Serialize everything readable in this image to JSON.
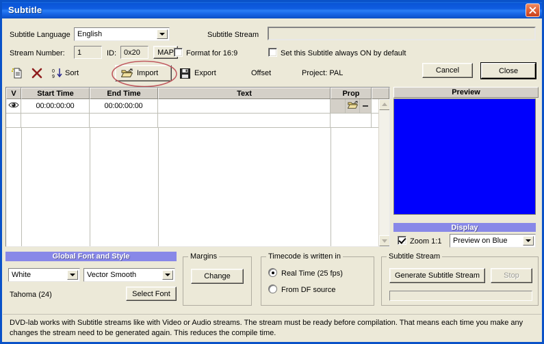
{
  "window": {
    "title": "Subtitle",
    "close_icon": "close-icon"
  },
  "top": {
    "language_label": "Subtitle Language",
    "language_value": "English",
    "stream_label": "Subtitle Stream",
    "stream_value": "",
    "stream_number_label": "Stream Number:",
    "stream_number_value": "1",
    "id_label": "ID:",
    "id_value": "0x20",
    "map_button": "MAP",
    "format_169_label": "Format for 16:9",
    "format_169_checked": false,
    "always_on_label": "Set this Subtitle always ON by default",
    "always_on_checked": false
  },
  "toolbar": {
    "new_icon": "new-document-icon",
    "delete_icon": "delete-x-icon",
    "sort_icon": "sort-icon",
    "sort_label": "Sort",
    "import_icon": "open-folder-icon",
    "import_label": "Import",
    "export_icon": "floppy-disk-icon",
    "export_label": "Export",
    "offset_label": "Offset",
    "project_label": "Project: PAL",
    "cancel_label": "Cancel",
    "close_label": "Close"
  },
  "grid": {
    "columns": [
      "V",
      "Start Time",
      "End Time",
      "Text",
      "Prop",
      ""
    ],
    "rows": [
      {
        "visible_icon": "eye-icon",
        "start_time": "00:00:00:00",
        "end_time": "00:00:00:00",
        "text": "",
        "prop_folder_icon": "open-folder-icon",
        "prop_minus_icon": "minus-icon"
      }
    ],
    "scroll_up_icon": "scroll-up-arrow-icon",
    "scroll_down_icon": "scroll-down-arrow-icon"
  },
  "preview": {
    "header": "Preview",
    "background_color": "#0000fd",
    "display_bar_label": "Display",
    "zoom_label": "Zoom 1:1",
    "zoom_checked": true,
    "mode_value": "Preview on Blue"
  },
  "font_style": {
    "header": "Global Font and Style",
    "color_value": "White",
    "render_value": "Vector Smooth",
    "current_font": "Tahoma (24)",
    "select_font_button": "Select Font"
  },
  "margins": {
    "group_title": "Margins",
    "change_button": "Change"
  },
  "timecode": {
    "group_title": "Timecode is written in",
    "options": [
      {
        "label": "Real Time (25 fps)",
        "selected": true
      },
      {
        "label": "From DF source",
        "selected": false
      }
    ]
  },
  "subtitle_stream": {
    "group_title": "Subtitle Stream",
    "generate_button": "Generate Subtitle Stream",
    "stop_button": "Stop",
    "progress_value": ""
  },
  "help": {
    "text": "DVD-lab works with Subtitle streams like with Video or Audio streams. The stream must be ready before compilation. That means each time you make any changes the stream need to be generated again. This reduces the compile time."
  },
  "annotation": {
    "shape": "red-ellipse-highlight",
    "color": "#c05a60",
    "target": "Import"
  }
}
